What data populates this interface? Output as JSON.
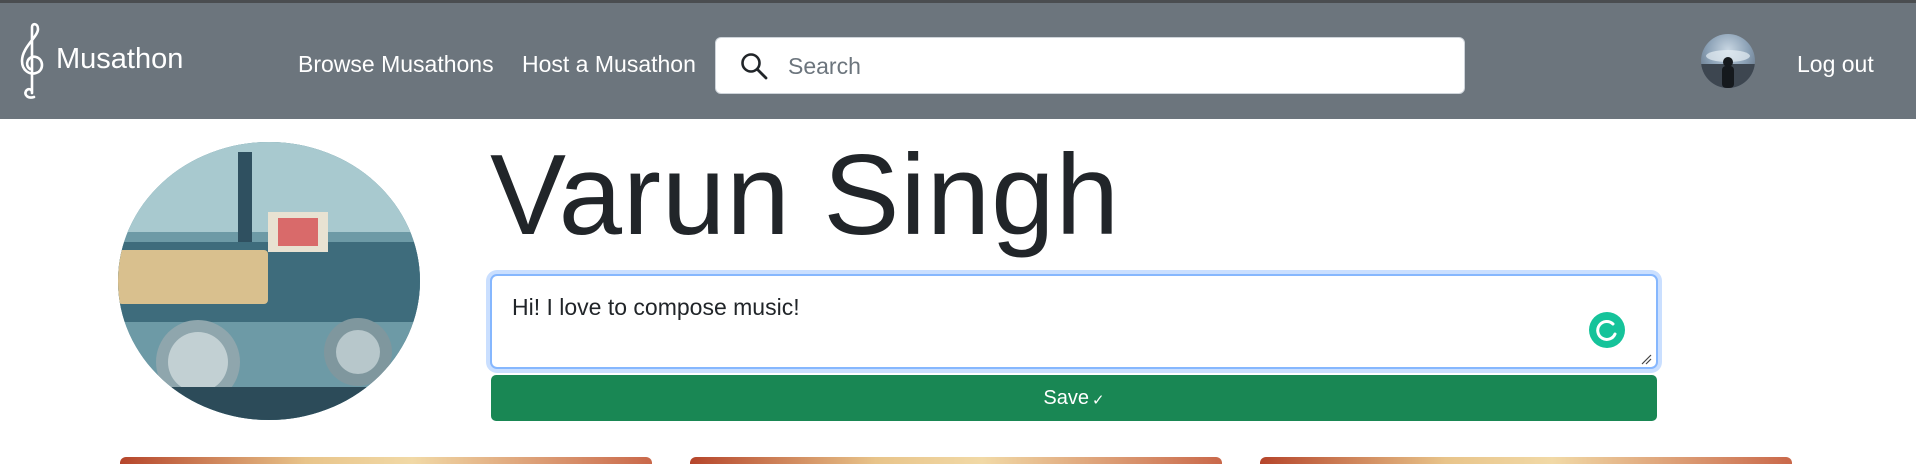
{
  "navbar": {
    "brand": "Musathon",
    "brand_icon": "treble-clef-icon",
    "links": [
      {
        "label": "Browse Musathons"
      },
      {
        "label": "Host a Musathon"
      }
    ],
    "search": {
      "placeholder": "Search",
      "value": "",
      "icon": "search-icon"
    },
    "logout_label": "Log out",
    "colors": {
      "background": "#6c757d",
      "text": "#ffffff"
    }
  },
  "profile": {
    "name": "Varun Singh",
    "bio": "Hi! I love to compose music!",
    "save_label": "Save",
    "save_icon": "✓",
    "colors": {
      "save_button": "#198754",
      "focus_ring": "#86b7fe",
      "grammarly": "#15c39a"
    }
  },
  "cards": [
    {
      "kind": "musathon-card"
    },
    {
      "kind": "musathon-card"
    },
    {
      "kind": "musathon-card"
    }
  ]
}
